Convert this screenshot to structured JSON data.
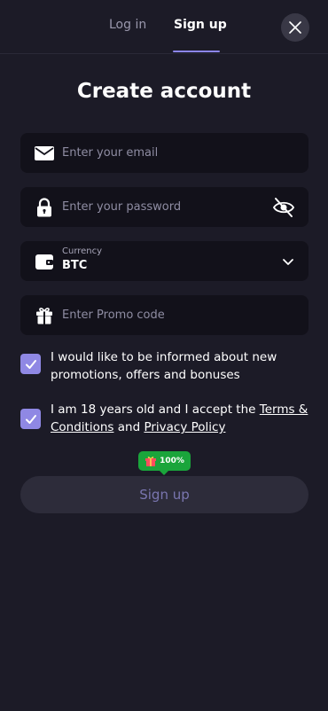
{
  "tabs": {
    "login": "Log in",
    "signup": "Sign up"
  },
  "title": "Create account",
  "email": {
    "placeholder": "Enter your email"
  },
  "password": {
    "placeholder": "Enter your password"
  },
  "currency": {
    "label": "Currency",
    "value": "BTC"
  },
  "promo": {
    "placeholder": "Enter Promo code"
  },
  "consent_promotions": {
    "text": "I would like to be informed about new promotions, offers and bonuses",
    "checked": true
  },
  "consent_terms": {
    "text_before": "I am 18 years old and I accept the ",
    "terms_link": "Terms & Conditions",
    "text_and": " and ",
    "privacy_link": "Privacy Policy",
    "checked": true
  },
  "bonus_badge": {
    "text": "100%"
  },
  "submit": {
    "label": "Sign up"
  },
  "colors": {
    "background": "#1c1b27",
    "field": "#12111a",
    "accent": "#8f88e4",
    "badge": "#1aa53b"
  }
}
